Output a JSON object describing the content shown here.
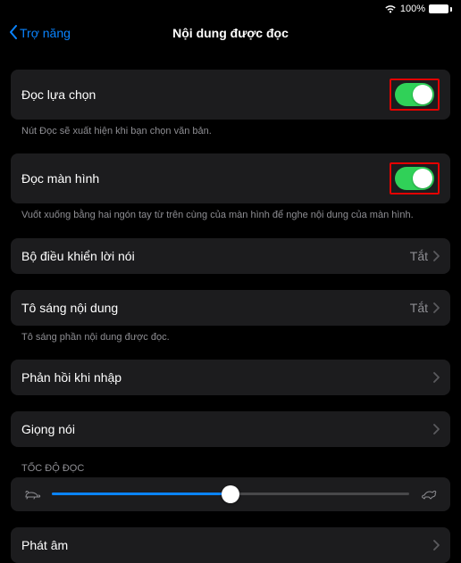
{
  "status": {
    "battery_pct": "100%"
  },
  "nav": {
    "back": "Trợ năng",
    "title": "Nội dung được đọc"
  },
  "rows": {
    "speak_selection": {
      "label": "Đọc lựa chọn",
      "footer": "Nút Đọc sẽ xuất hiện khi bạn chọn văn bản."
    },
    "speak_screen": {
      "label": "Đọc màn hình",
      "footer": "Vuốt xuống bằng hai ngón tay từ trên cùng của màn hình để nghe nội dung của màn hình."
    },
    "speech_controller": {
      "label": "Bộ điều khiển lời nói",
      "value": "Tắt"
    },
    "highlight_content": {
      "label": "Tô sáng nội dung",
      "value": "Tắt",
      "footer": "Tô sáng phần nội dung được đọc."
    },
    "typing_feedback": {
      "label": "Phản hồi khi nhập"
    },
    "voices": {
      "label": "Giọng nói"
    },
    "speed_header": "TỐC ĐỘ ĐỌC",
    "pronunciations": {
      "label": "Phát âm"
    }
  },
  "slider": {
    "value": 50
  }
}
